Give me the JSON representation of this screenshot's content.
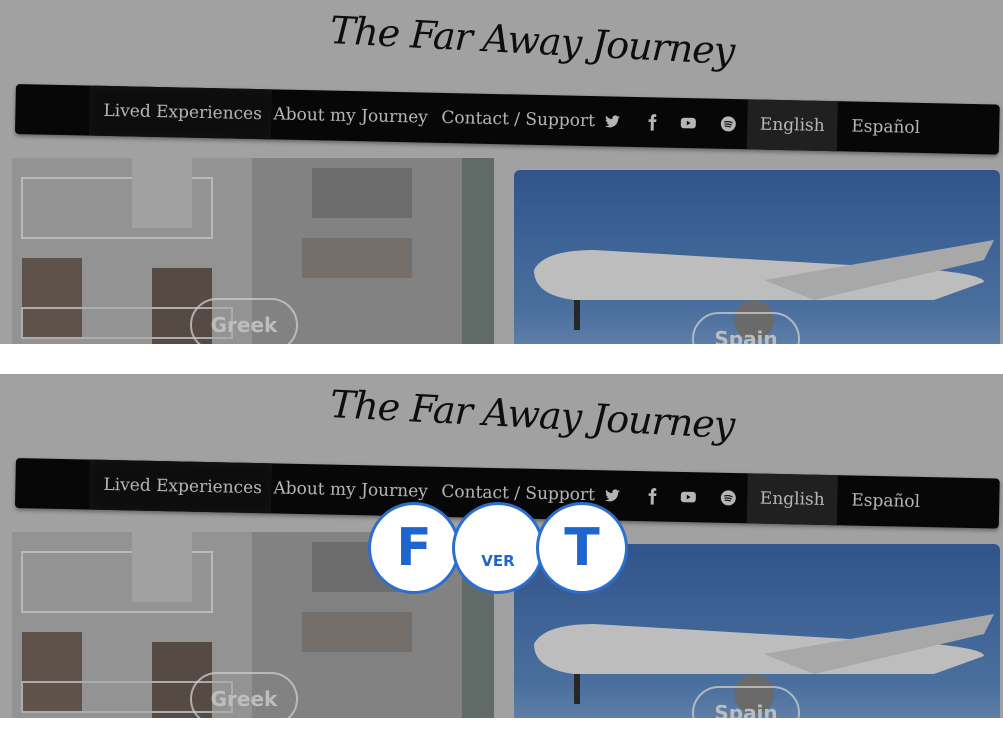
{
  "site": {
    "logo_text": "The Far Away Journey"
  },
  "nav": {
    "items": [
      {
        "label": "Lived Experiences"
      },
      {
        "label": "About my Journey"
      },
      {
        "label": "Contact / Support"
      }
    ],
    "languages": [
      "English",
      "Español"
    ],
    "social_icons": [
      "twitter-icon",
      "facebook-icon",
      "youtube-icon",
      "spotify-icon"
    ]
  },
  "cards": [
    {
      "label": "Greek"
    },
    {
      "label": "Spain"
    }
  ],
  "overlay": {
    "left_letter": "F",
    "middle_text": "VER",
    "right_letter": "T"
  },
  "colors": {
    "navbar_bg": "#0a0a0a",
    "badge_blue": "#1f65cf"
  }
}
